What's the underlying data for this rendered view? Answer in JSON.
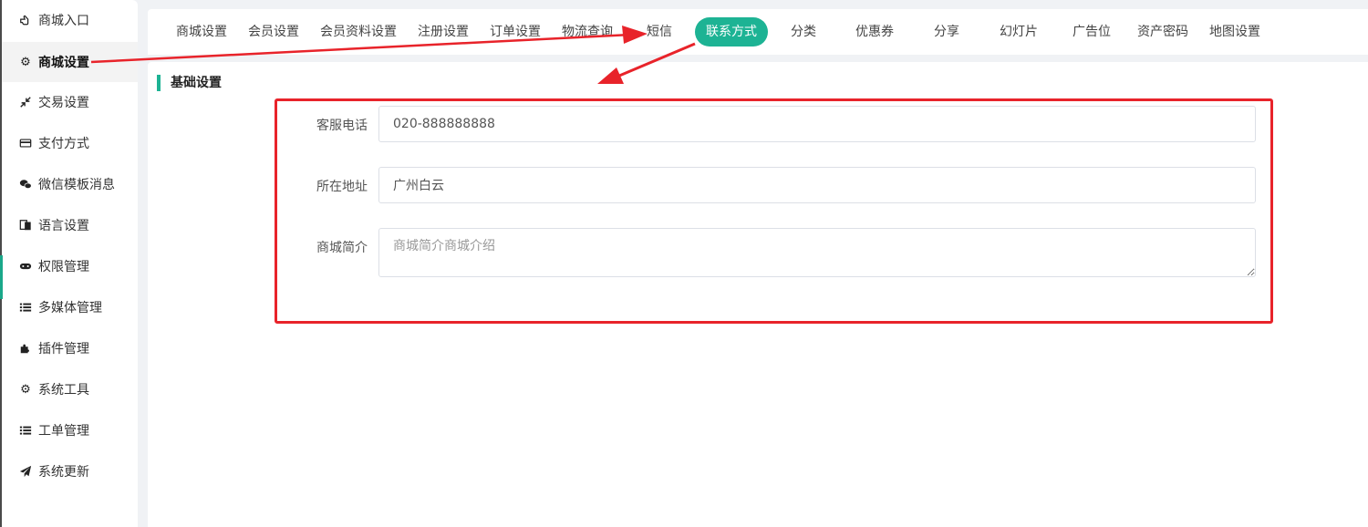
{
  "sidebar": {
    "items": [
      {
        "label": "商城入口",
        "icon": "hand-point-icon"
      },
      {
        "label": "商城设置",
        "icon": "gear-icon"
      },
      {
        "label": "交易设置",
        "icon": "compress-arrows-icon"
      },
      {
        "label": "支付方式",
        "icon": "credit-card-icon"
      },
      {
        "label": "微信模板消息",
        "icon": "wechat-icon"
      },
      {
        "label": "语言设置",
        "icon": "language-icon"
      },
      {
        "label": "权限管理",
        "icon": "gamepad-icon"
      },
      {
        "label": "多媒体管理",
        "icon": "list-icon"
      },
      {
        "label": "插件管理",
        "icon": "puzzle-icon"
      },
      {
        "label": "系统工具",
        "icon": "gear-icon"
      },
      {
        "label": "工单管理",
        "icon": "list-icon"
      },
      {
        "label": "系统更新",
        "icon": "paper-plane-icon"
      }
    ],
    "active_index": 1
  },
  "tabs": [
    "商城设置",
    "会员设置",
    "会员资料设置",
    "注册设置",
    "订单设置",
    "物流查询",
    "短信",
    "联系方式",
    "分类",
    "优惠券",
    "分享",
    "幻灯片",
    "广告位",
    "资产密码",
    "地图设置"
  ],
  "active_tab": "联系方式",
  "section": {
    "title": "基础设置"
  },
  "form": {
    "phone": {
      "label": "客服电话",
      "value": "020-888888888"
    },
    "address": {
      "label": "所在地址",
      "value": "广州白云"
    },
    "intro": {
      "label": "商城简介",
      "placeholder": "商城简介商城介绍"
    }
  },
  "colors": {
    "accent": "#1db394",
    "annotation_red": "#e8232a"
  }
}
